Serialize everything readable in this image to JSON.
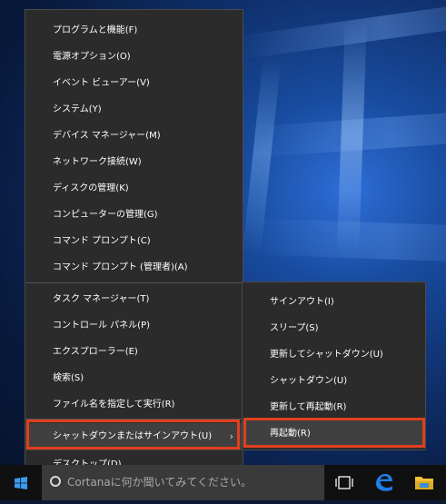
{
  "main_menu": {
    "group1": [
      {
        "label": "プログラムと機能(F)"
      },
      {
        "label": "電源オプション(O)"
      },
      {
        "label": "イベント ビューアー(V)"
      },
      {
        "label": "システム(Y)"
      },
      {
        "label": "デバイス マネージャー(M)"
      },
      {
        "label": "ネットワーク接続(W)"
      },
      {
        "label": "ディスクの管理(K)"
      },
      {
        "label": "コンピューターの管理(G)"
      },
      {
        "label": "コマンド プロンプト(C)"
      },
      {
        "label": "コマンド プロンプト (管理者)(A)"
      }
    ],
    "group2": [
      {
        "label": "タスク マネージャー(T)"
      },
      {
        "label": "コントロール パネル(P)"
      },
      {
        "label": "エクスプローラー(E)"
      },
      {
        "label": "検索(S)"
      },
      {
        "label": "ファイル名を指定して実行(R)"
      }
    ],
    "shutdown": {
      "label": "シャットダウンまたはサインアウト(U)",
      "chevron": "›"
    },
    "desktop": {
      "label": "デスクトップ(D)"
    }
  },
  "submenu": {
    "items": [
      {
        "label": "サインアウト(I)"
      },
      {
        "label": "スリープ(S)"
      },
      {
        "label": "更新してシャットダウン(U)"
      },
      {
        "label": "シャットダウン(U)"
      },
      {
        "label": "更新して再起動(R)"
      },
      {
        "label": "再起動(R)"
      }
    ]
  },
  "taskbar": {
    "search_placeholder": "Cortanaに何か聞いてみてください。",
    "icons": [
      "windows-logo-icon",
      "cortana-icon",
      "task-view-icon",
      "edge-icon",
      "file-explorer-icon"
    ]
  },
  "colors": {
    "menu_bg": "#2b2b2b",
    "menu_hover": "#404040",
    "highlight_border": "#e23e1e",
    "taskbar_bg": "#101010",
    "edge_blue": "#1f7de8",
    "folder_yellow": "#f4c233"
  }
}
